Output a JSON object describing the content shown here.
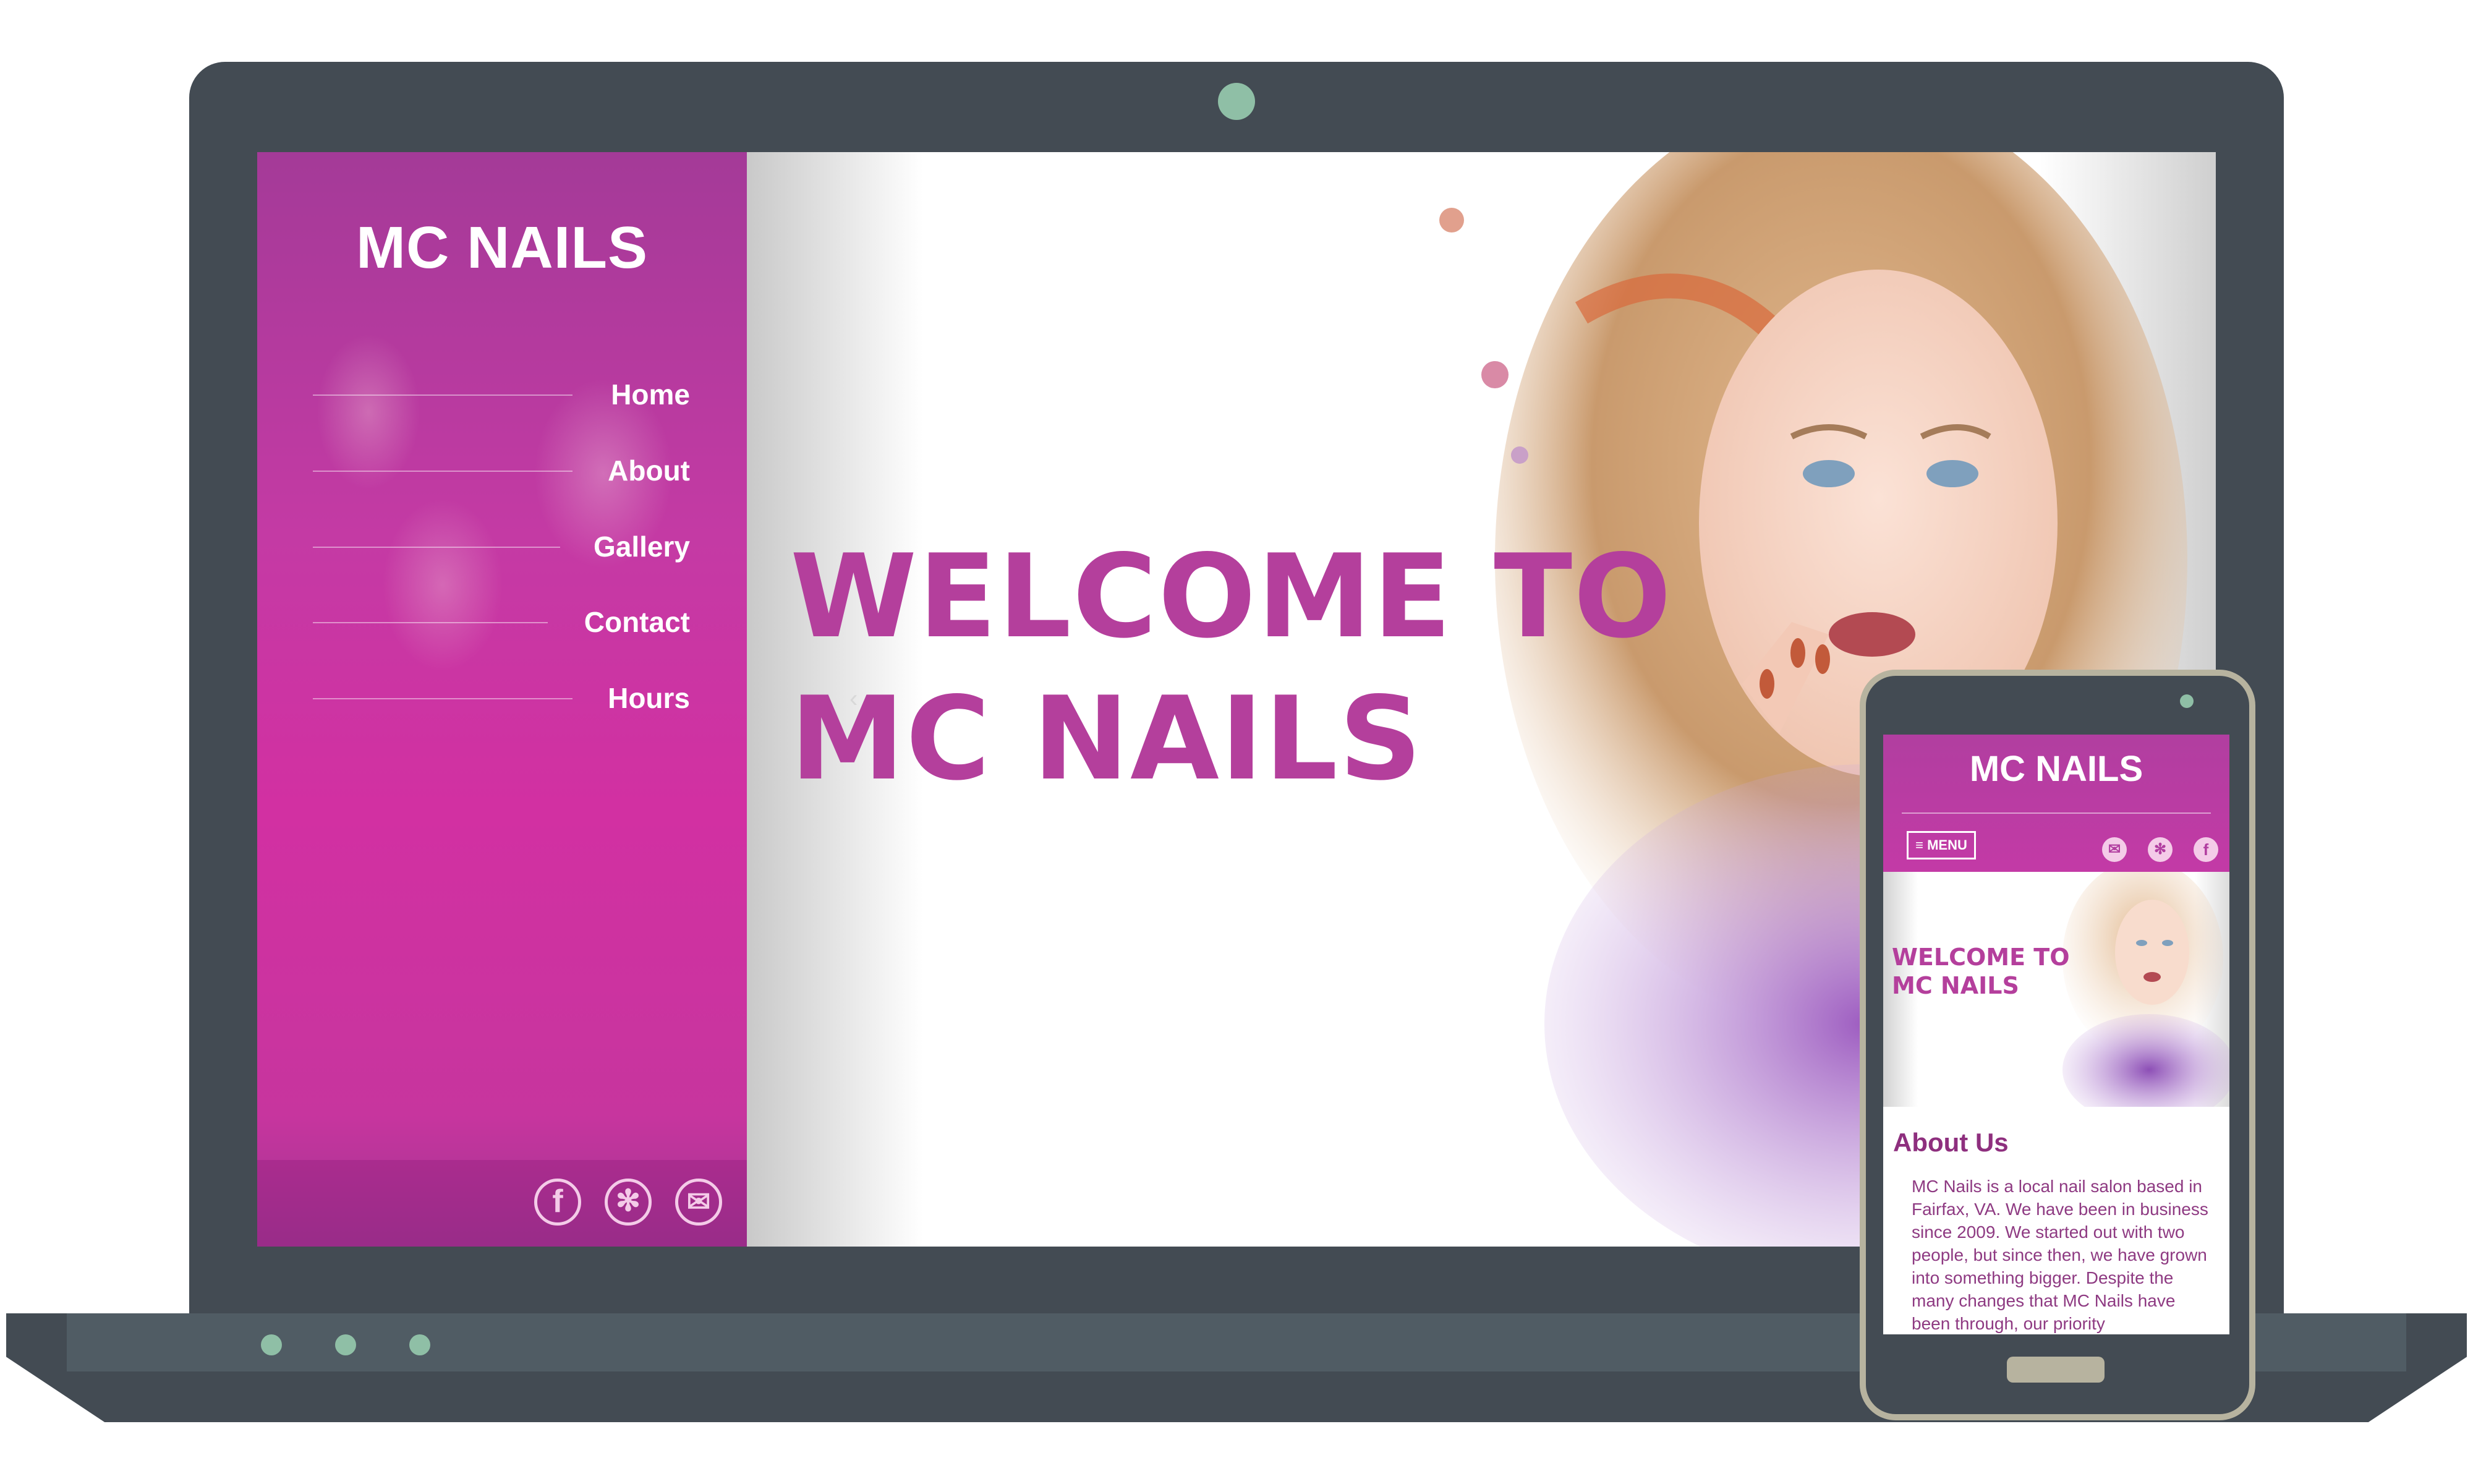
{
  "site": {
    "brand": "MC NAILS",
    "nav": [
      "Home",
      "About",
      "Gallery",
      "Contact",
      "Hours"
    ],
    "hero_title_line1": "WELCOME TO",
    "hero_title_line2": "MC NAILS",
    "slider_prev_glyph": "‹",
    "social": [
      {
        "name": "facebook-icon",
        "glyph": "f"
      },
      {
        "name": "yelp-icon",
        "glyph": "✻"
      },
      {
        "name": "email-icon",
        "glyph": "✉"
      }
    ]
  },
  "mobile": {
    "brand": "MC NAILS",
    "menu_label": "≡ MENU",
    "hero_title_line1": "WELCOME TO",
    "hero_title_line2": "MC NAILS",
    "section_title": "About Us",
    "about_text": "MC Nails is a local nail salon based in Fairfax, VA. We have been in business since 2009. We started out with two people, but since then, we have grown into something bigger. Despite the many changes that MC Nails have been through, our priority"
  },
  "colors": {
    "accent": "#b43f9c",
    "sidebar": "#d230a2",
    "device_frame": "#434b53",
    "indicator": "#8fbfa6"
  }
}
